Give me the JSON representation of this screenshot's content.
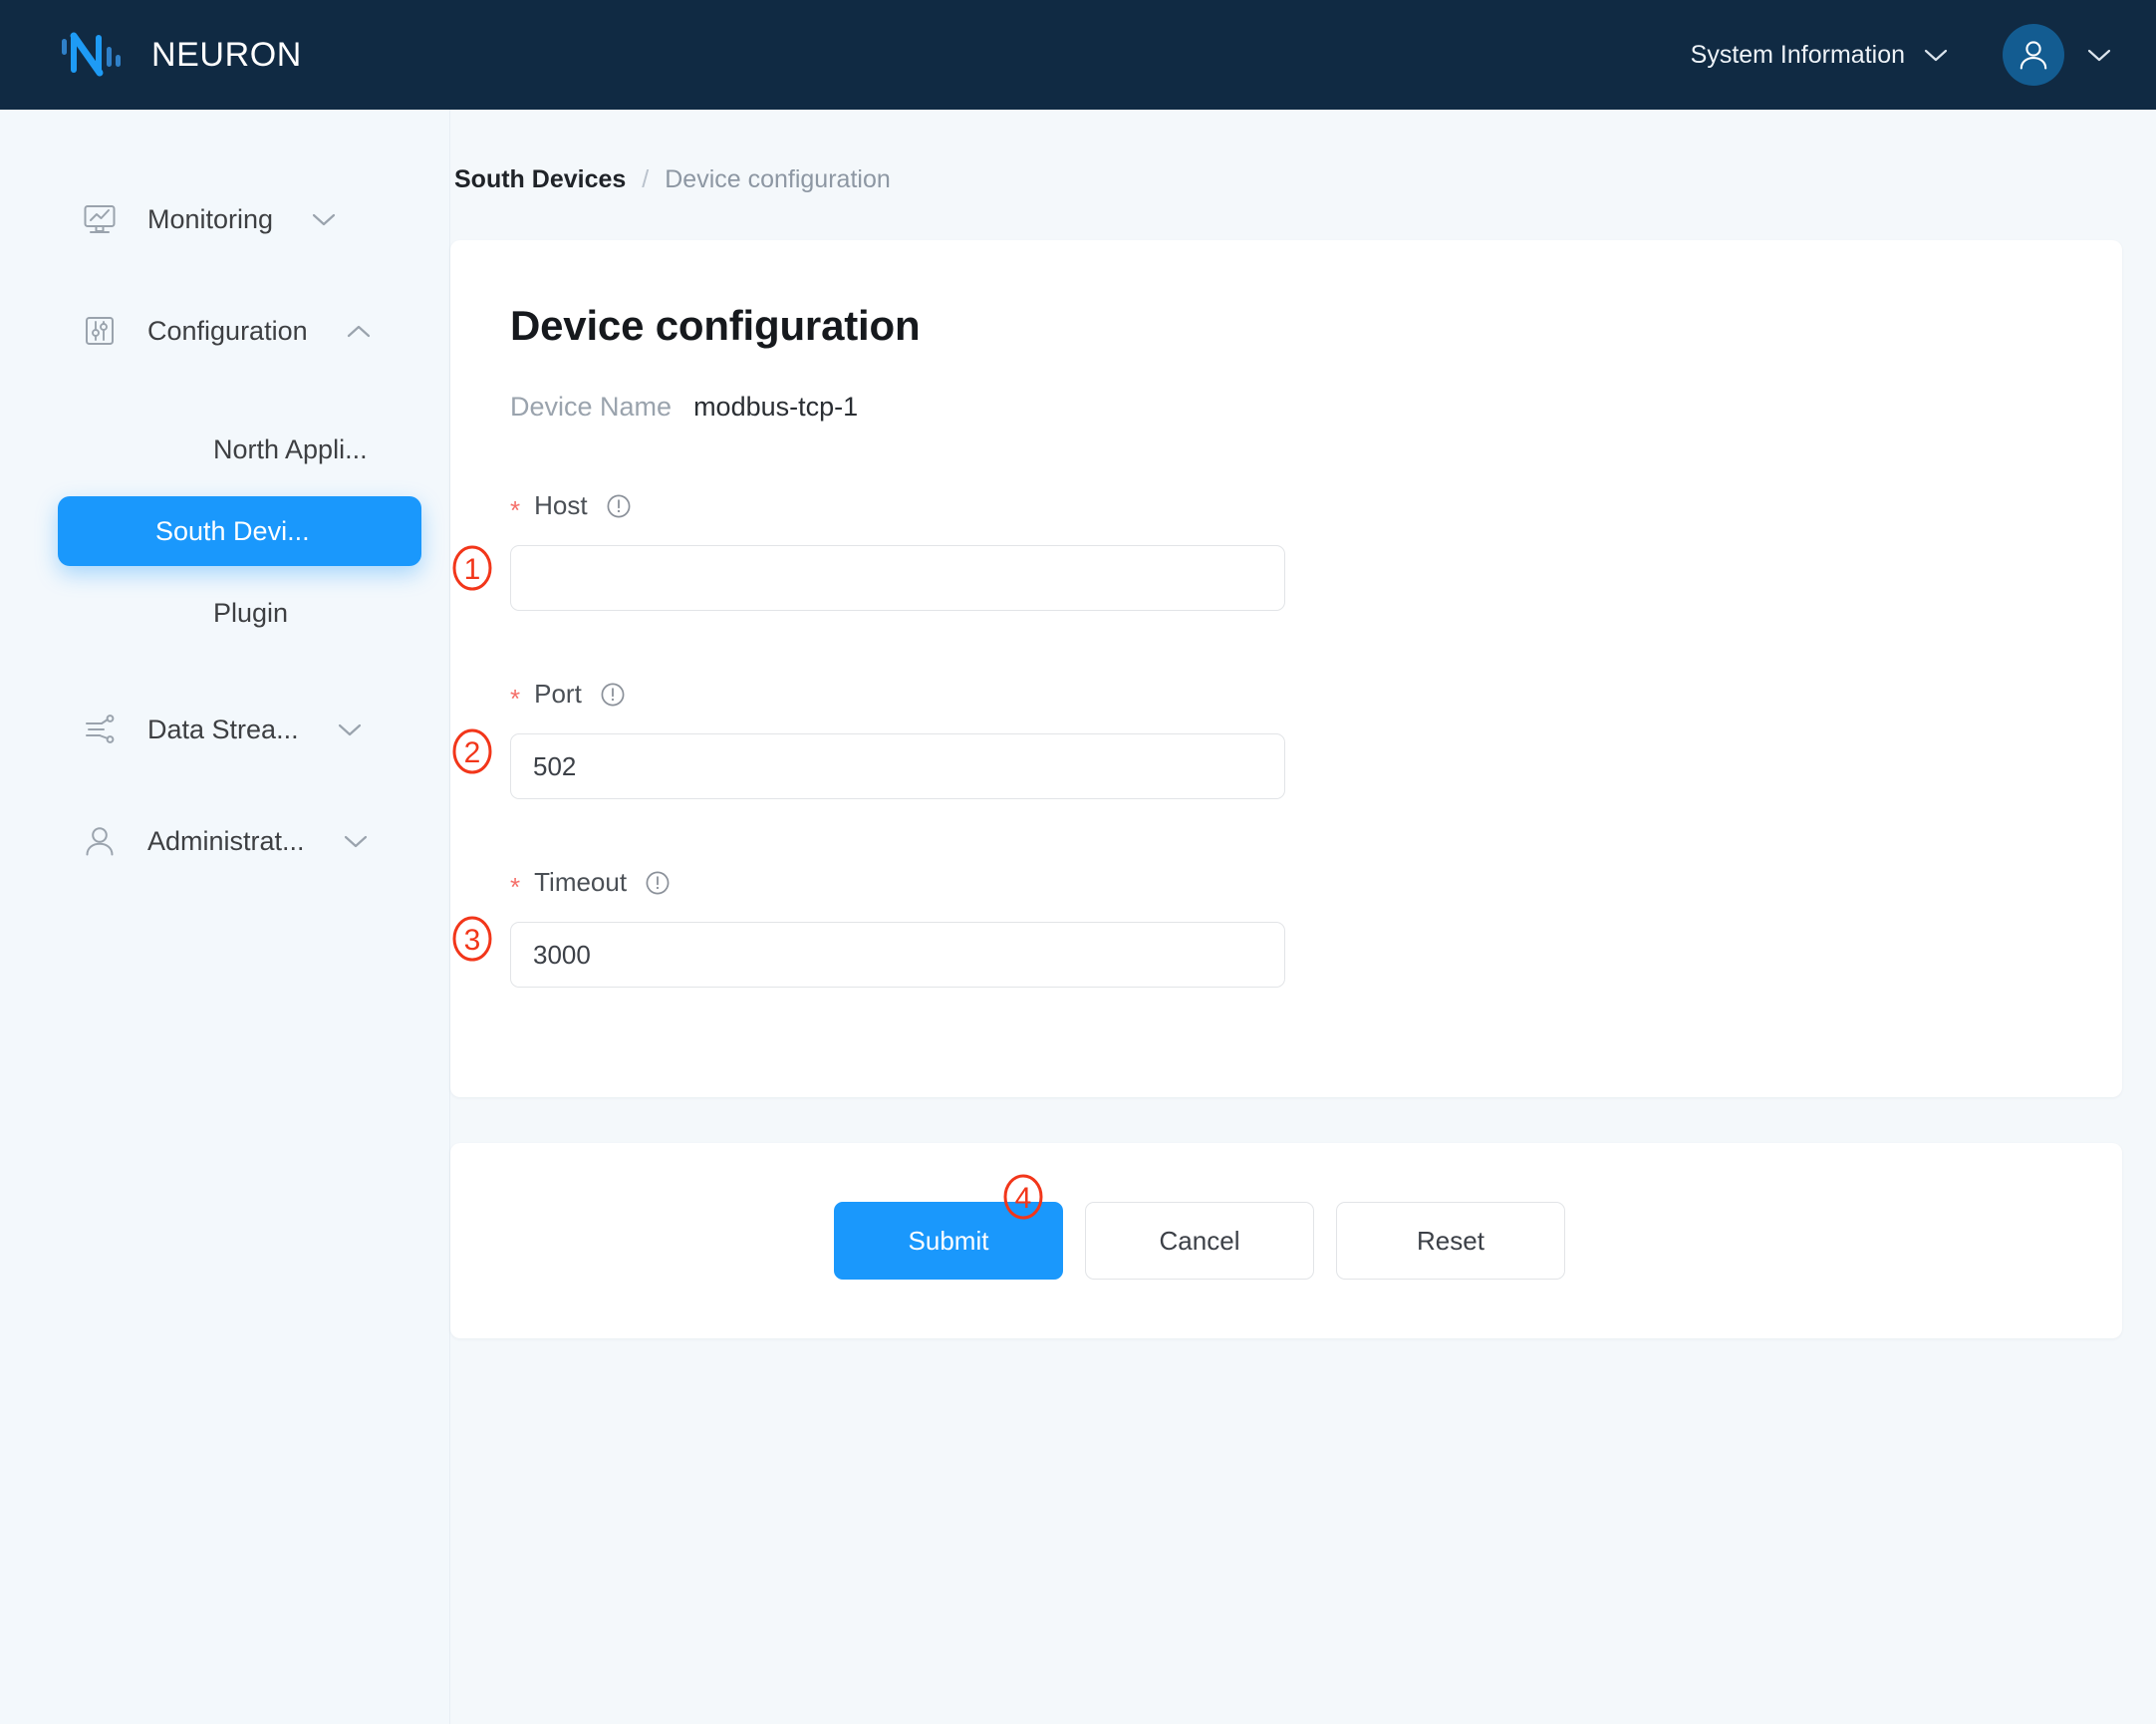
{
  "header": {
    "brand_name": "NEURON",
    "logo_icon": "neuron-logo-icon",
    "system_information_label": "System Information",
    "system_info_caret_icon": "chevron-down-icon",
    "avatar_icon": "user-avatar-icon",
    "avatar_caret_icon": "chevron-down-icon",
    "background_color": "#102a43"
  },
  "sidebar": {
    "groups": [
      {
        "label": "Monitoring",
        "icon": "monitor-chart-icon",
        "caret": "chevron-down-icon",
        "expanded": false,
        "items": []
      },
      {
        "label": "Configuration",
        "icon": "sliders-icon",
        "caret": "chevron-up-icon",
        "expanded": true,
        "items": [
          {
            "label": "North Appli...",
            "active": false
          },
          {
            "label": "South Devi...",
            "active": true
          },
          {
            "label": "Plugin",
            "active": false
          }
        ]
      },
      {
        "label": "Data Strea...",
        "icon": "data-stream-icon",
        "caret": "chevron-down-icon",
        "expanded": false,
        "items": []
      },
      {
        "label": "Administrat...",
        "icon": "user-icon",
        "caret": "chevron-down-icon",
        "expanded": false,
        "items": []
      }
    ],
    "active_color": "#1a98fc"
  },
  "breadcrumb": {
    "root": "South Devices",
    "separator": "/",
    "current": "Device configuration"
  },
  "form": {
    "title": "Device configuration",
    "device_name_label": "Device Name",
    "device_name_value": "modbus-tcp-1",
    "required_marker": "*",
    "info_icon": "info-circle-icon",
    "fields": [
      {
        "label": "Host",
        "required": true,
        "value": "",
        "placeholder": ""
      },
      {
        "label": "Port",
        "required": true,
        "value": "502",
        "placeholder": ""
      },
      {
        "label": "Timeout",
        "required": true,
        "value": "3000",
        "placeholder": ""
      }
    ]
  },
  "actions": {
    "submit_label": "Submit",
    "cancel_label": "Cancel",
    "reset_label": "Reset",
    "primary_color": "#1a98fc"
  },
  "annotations": {
    "color": "#f2361a",
    "markers": [
      {
        "number": "1",
        "target": "host-field"
      },
      {
        "number": "2",
        "target": "port-field"
      },
      {
        "number": "3",
        "target": "timeout-field"
      },
      {
        "number": "4",
        "target": "submit-button"
      }
    ]
  }
}
